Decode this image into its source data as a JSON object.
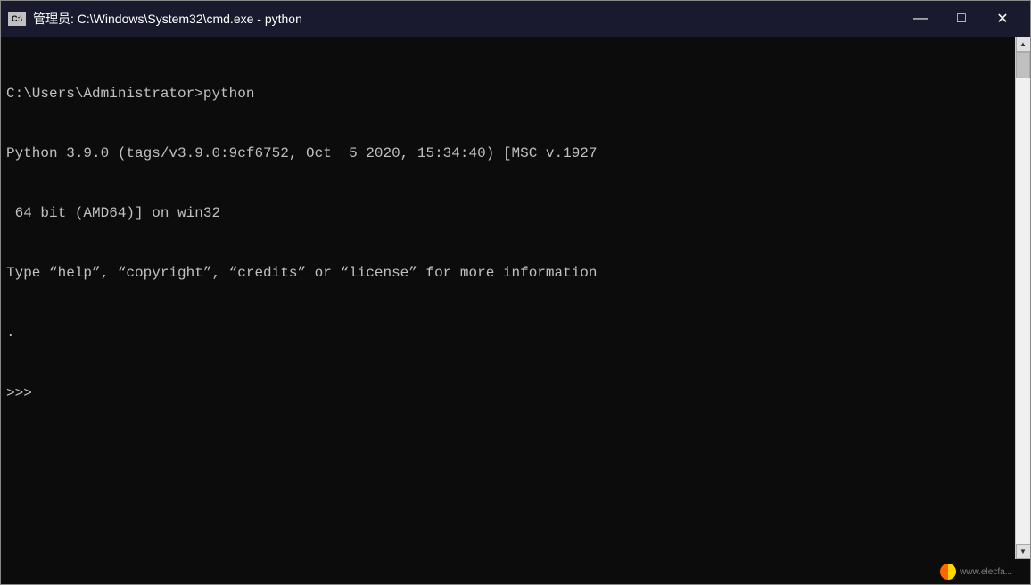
{
  "titleBar": {
    "iconLabel": "C:\\",
    "title": "管理员: C:\\Windows\\System32\\cmd.exe - python",
    "minimizeLabel": "—",
    "maximizeLabel": "□",
    "closeLabel": "✕"
  },
  "terminal": {
    "line1": "C:\\Users\\Administrator>python",
    "line2": "Python 3.9.0 (tags/v3.9.0:9cf6752, Oct  5 2020, 15:34:40) [MSC v.1927",
    "line3": " 64 bit (AMD64)] on win32",
    "line4": "Type “help”, “copyright”, “credits” or “license” for more information",
    "line5": ".",
    "line6": ">>> "
  },
  "watermark": {
    "text": "www.elecfa..."
  }
}
